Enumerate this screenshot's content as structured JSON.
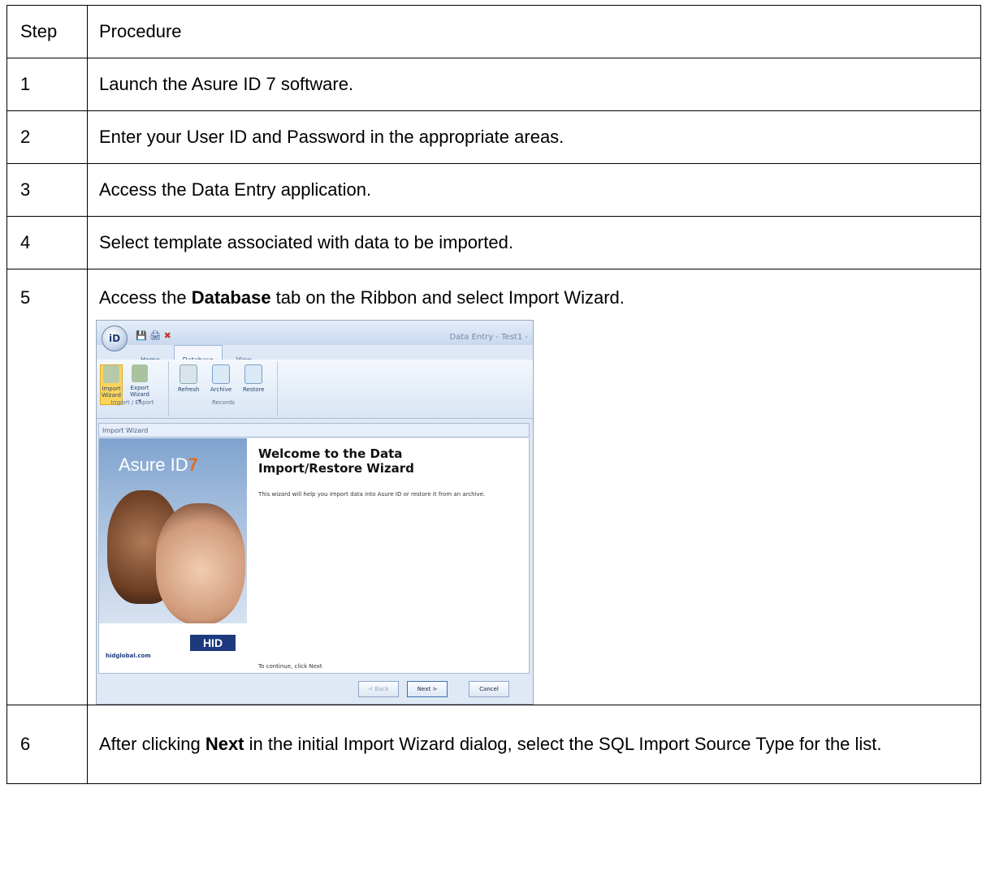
{
  "table": {
    "header": {
      "step": "Step",
      "procedure": "Procedure"
    },
    "rows": [
      {
        "step": "1",
        "text": "Launch the Asure ID 7 software."
      },
      {
        "step": "2",
        "text": "Enter your User ID and Password in the appropriate areas."
      },
      {
        "step": "3",
        "text": "Access the Data Entry application."
      },
      {
        "step": "4",
        "text": "Select template associated with data to be imported."
      },
      {
        "step": "5",
        "pre": "Access the ",
        "bold": "Database",
        "post": " tab on the Ribbon and select Import Wizard."
      },
      {
        "step": "6",
        "pre": "After clicking ",
        "bold": "Next",
        "post": " in the initial Import Wizard dialog, select the SQL Import Source Type for the list."
      }
    ]
  },
  "screenshot": {
    "window_title": "Data Entry - Test1 -",
    "app_logo": "iD",
    "tabs": [
      "Home",
      "Database",
      "View"
    ],
    "ribbon": {
      "import_export": {
        "label": "Import / Export",
        "buttons": [
          "Import Wizard",
          "Export Wizard ▾"
        ]
      },
      "records": {
        "label": "Records",
        "buttons": [
          "Refresh",
          "Archive",
          "Restore"
        ]
      }
    },
    "wizard": {
      "header": "Import Wizard",
      "brand": "Asure ID",
      "brand_version": "7",
      "title_line1": "Welcome to the Data",
      "title_line2": "Import/Restore Wizard",
      "description": "This wizard will help you import data into Asure ID or restore it from an archive.",
      "continue_text": "To continue, click Next",
      "hid_logo": "HID",
      "url": "hidglobal.com",
      "buttons": {
        "back": "< Back",
        "next": "Next >",
        "cancel": "Cancel"
      }
    }
  }
}
